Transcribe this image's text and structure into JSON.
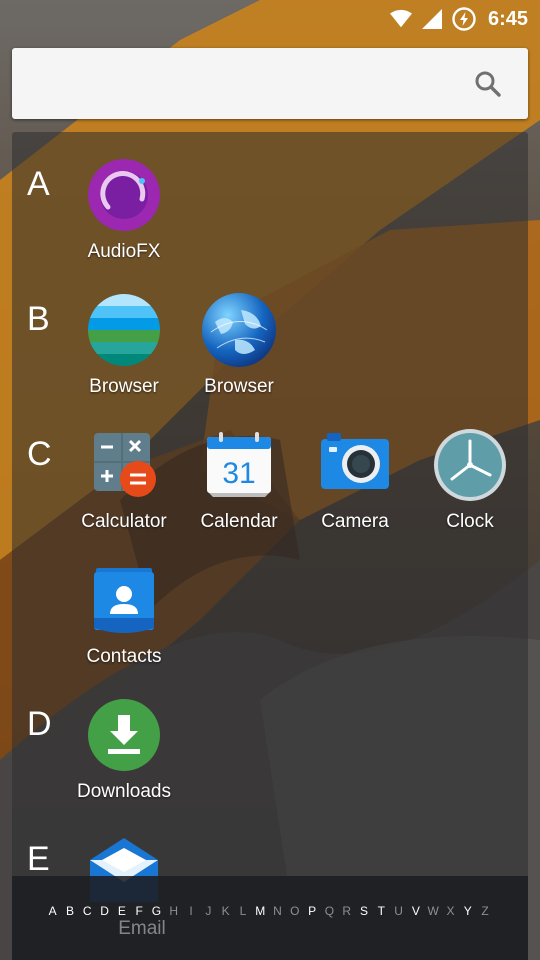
{
  "status_bar": {
    "time": "6:45",
    "icons": [
      "wifi-icon",
      "signal-icon",
      "battery-charging-icon"
    ]
  },
  "search": {
    "placeholder": "",
    "icon": "search-icon"
  },
  "sections": [
    {
      "letter": "A",
      "apps": [
        {
          "label": "AudioFX",
          "icon": "audiofx-icon"
        }
      ]
    },
    {
      "letter": "B",
      "apps": [
        {
          "label": "Browser",
          "icon": "browser-stripes-icon"
        },
        {
          "label": "Browser",
          "icon": "globe-icon"
        }
      ]
    },
    {
      "letter": "C",
      "apps": [
        {
          "label": "Calculator",
          "icon": "calculator-icon"
        },
        {
          "label": "Calendar",
          "icon": "calendar-icon",
          "day": "31"
        },
        {
          "label": "Camera",
          "icon": "camera-icon"
        },
        {
          "label": "Clock",
          "icon": "clock-icon"
        },
        {
          "label": "Contacts",
          "icon": "contacts-icon"
        }
      ]
    },
    {
      "letter": "D",
      "apps": [
        {
          "label": "Downloads",
          "icon": "download-icon"
        }
      ]
    },
    {
      "letter": "E",
      "apps": [
        {
          "label": "Email",
          "icon": "email-icon"
        }
      ]
    }
  ],
  "scrubber": {
    "letters": [
      "A",
      "B",
      "C",
      "D",
      "E",
      "F",
      "G",
      "H",
      "I",
      "J",
      "K",
      "L",
      "M",
      "N",
      "O",
      "P",
      "Q",
      "R",
      "S",
      "T",
      "U",
      "V",
      "W",
      "X",
      "Y",
      "Z"
    ],
    "active": [
      "A",
      "B",
      "C",
      "D",
      "E",
      "F",
      "G",
      "M",
      "P",
      "S",
      "T",
      "V",
      "Y"
    ]
  },
  "colors": {
    "panel": "#2d2d30",
    "search_bg": "#f5f5f5",
    "text": "#ffffff",
    "scrub_inactive": "#8b8f96"
  }
}
